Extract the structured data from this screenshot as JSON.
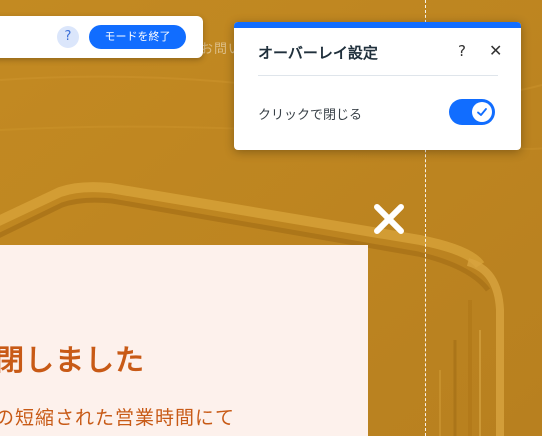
{
  "background": {
    "faint_text": "お問い"
  },
  "toolbar": {
    "help_label": "?",
    "exit_label": "モードを終了"
  },
  "panel": {
    "title": "オーバーレイ設定",
    "help_label": "?",
    "close_label": "✕",
    "toggle_label": "クリックで閉じる",
    "toggle_on": true
  },
  "card": {
    "heading": "閉しました",
    "body": "の短縮された営業時間にて"
  },
  "colors": {
    "accent": "#116dff",
    "background": "#c99128",
    "card_background": "#fdf1ec",
    "card_text": "#c85a16"
  }
}
